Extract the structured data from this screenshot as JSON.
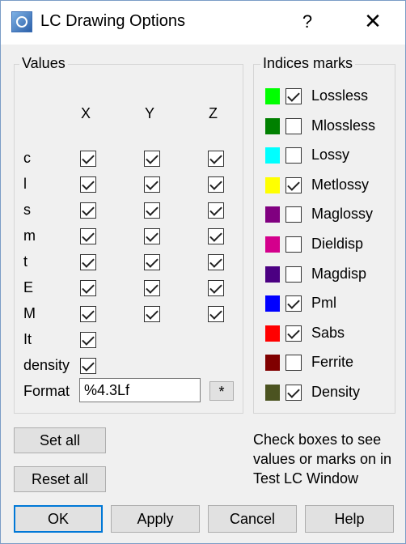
{
  "window": {
    "title": "LC Drawing Options",
    "help_label": "?",
    "close_label": "✕"
  },
  "values": {
    "group_label": "Values",
    "columns": [
      "X",
      "Y",
      "Z"
    ],
    "rows": [
      {
        "label": "c",
        "x": true,
        "y": true,
        "z": true
      },
      {
        "label": "l",
        "x": true,
        "y": true,
        "z": true
      },
      {
        "label": "s",
        "x": true,
        "y": true,
        "z": true
      },
      {
        "label": "m",
        "x": true,
        "y": true,
        "z": true
      },
      {
        "label": "t",
        "x": true,
        "y": true,
        "z": true
      },
      {
        "label": "E",
        "x": true,
        "y": true,
        "z": true
      },
      {
        "label": "M",
        "x": true,
        "y": true,
        "z": true
      },
      {
        "label": "It",
        "x": true
      },
      {
        "label": "density",
        "x": true
      }
    ],
    "format_label": "Format",
    "format_value": "%4.3Lf",
    "star_label": "*"
  },
  "indices": {
    "group_label": "Indices marks",
    "items": [
      {
        "label": "Lossless",
        "color": "#00ff00",
        "checked": true
      },
      {
        "label": "Mlossless",
        "color": "#008000",
        "checked": false
      },
      {
        "label": "Lossy",
        "color": "#00ffff",
        "checked": false
      },
      {
        "label": "Metlossy",
        "color": "#ffff00",
        "checked": true
      },
      {
        "label": "Maglossy",
        "color": "#800080",
        "checked": false
      },
      {
        "label": "Dieldisp",
        "color": "#d4008c",
        "checked": false
      },
      {
        "label": "Magdisp",
        "color": "#4b0082",
        "checked": false
      },
      {
        "label": "Pml",
        "color": "#0000ff",
        "checked": true
      },
      {
        "label": "Sabs",
        "color": "#ff0000",
        "checked": true
      },
      {
        "label": "Ferrite",
        "color": "#800000",
        "checked": false
      },
      {
        "label": "Density",
        "color": "#4b5320",
        "checked": true
      }
    ]
  },
  "buttons": {
    "set_all": "Set all",
    "reset_all": "Reset all",
    "ok": "OK",
    "apply": "Apply",
    "cancel": "Cancel",
    "help": "Help"
  },
  "note": "Check boxes to see values or marks on in Test LC Window"
}
